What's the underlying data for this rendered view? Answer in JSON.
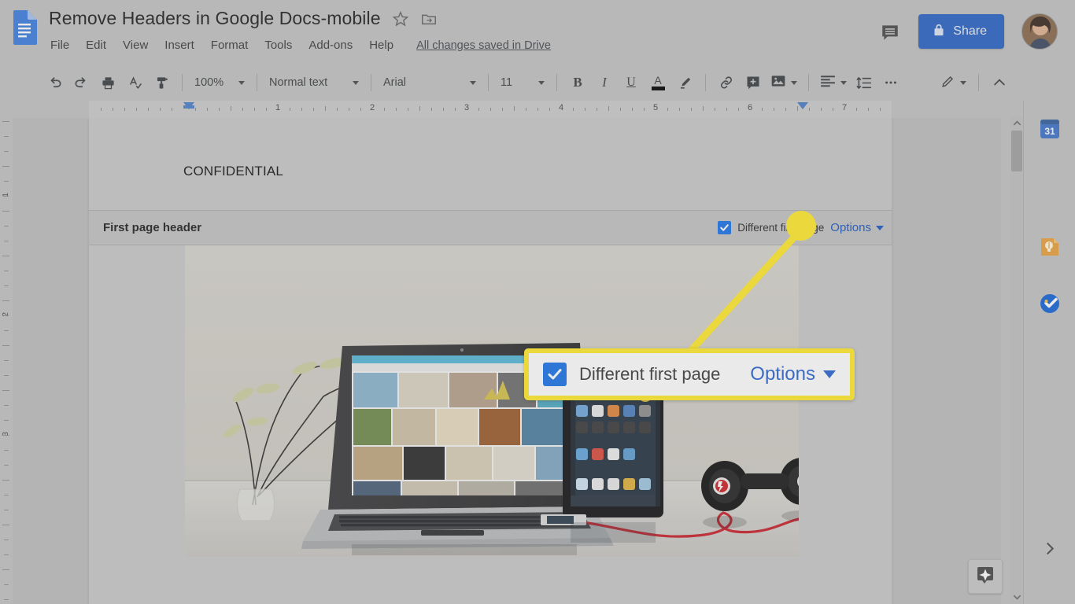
{
  "app": {
    "name": "Google Docs",
    "logo_icon": "google-docs-logo-icon"
  },
  "titlebar": {
    "doc_title": "Remove Headers in Google Docs-mobile",
    "star_icon": "star-icon",
    "move_folder_icon": "move-to-folder-icon",
    "menus": [
      "File",
      "Edit",
      "View",
      "Insert",
      "Format",
      "Tools",
      "Add-ons",
      "Help"
    ],
    "save_status": "All changes saved in Drive",
    "comment_icon": "comment-history-icon",
    "share_label": "Share",
    "share_lock_icon": "lock-icon",
    "share_color": "#2b63c6",
    "avatar_name": "account-avatar"
  },
  "toolbar": {
    "undo_icon": "undo-icon",
    "redo_icon": "redo-icon",
    "print_icon": "print-icon",
    "spellcheck_icon": "spellcheck-icon",
    "paint_format_icon": "paint-format-icon",
    "zoom_value": "100%",
    "style_value": "Normal text",
    "font_value": "Arial",
    "font_size_value": "11",
    "bold_label": "B",
    "italic_label": "I",
    "underline_label": "U",
    "text_color_label": "A",
    "text_color_swatch": "#000000",
    "highlight_icon": "highlight-pen-icon",
    "link_icon": "insert-link-icon",
    "comment_icon": "add-comment-icon",
    "image_icon": "insert-image-icon",
    "align_icon": "align-left-icon",
    "line_spacing_icon": "line-spacing-icon",
    "more_icon": "more-options-icon",
    "edit_mode_icon": "editing-pencil-icon",
    "collapse_icon": "hide-menus-chevron-up-icon"
  },
  "ruler": {
    "numbers": [
      "1",
      "2",
      "3",
      "4",
      "5",
      "6",
      "7"
    ],
    "left_indent_marker": "left-indent-marker",
    "right_indent_marker": "right-indent-marker",
    "vertical_numbers": [
      "1",
      "2",
      "3"
    ]
  },
  "outline": {
    "icon": "document-outline-icon"
  },
  "document": {
    "body_text": "CONFIDENTIAL",
    "header_section_label": "First page header",
    "different_first_page_label": "Different first page",
    "different_first_page_checked": true,
    "options_label": "Options",
    "options_color": "#1a56c4",
    "image_alt": "laptop tablet and headphones on a desk"
  },
  "callout": {
    "checkbox_checked": true,
    "label": "Different first page",
    "options_label": "Options",
    "border_color": "#ffe92b",
    "options_color": "#2a64d0"
  },
  "annotation": {
    "highlight_color": "#ffe92b",
    "circle_name": "highlight-circle",
    "connector_name": "callout-connector-line"
  },
  "right_sidebar": {
    "items": [
      {
        "name": "google-calendar-icon",
        "label": "31"
      },
      {
        "name": "google-keep-icon",
        "label": ""
      },
      {
        "name": "google-tasks-icon",
        "label": ""
      }
    ],
    "expand_icon": "expand-sidebar-chevron-right-icon"
  },
  "scrollbar": {
    "up_icon": "scroll-up-chevron-icon",
    "down_icon": "scroll-down-chevron-icon",
    "thumb_name": "vertical-scroll-thumb"
  },
  "explore": {
    "icon": "explore-star-icon"
  }
}
